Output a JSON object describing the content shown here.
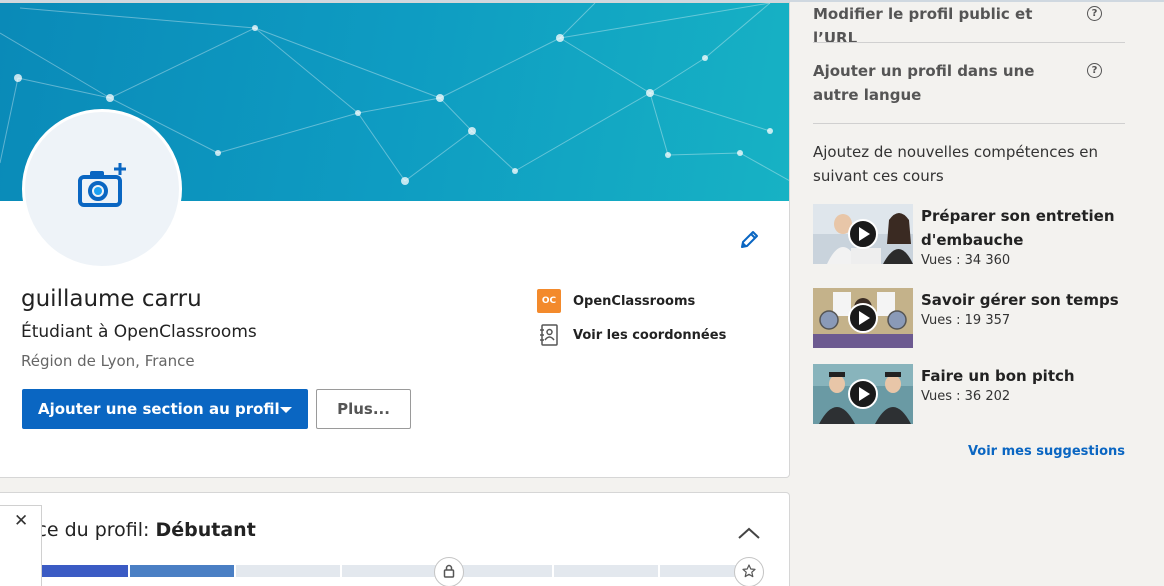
{
  "profile": {
    "name": "guillaume carru",
    "headline": "Étudiant à OpenClassrooms",
    "location": "Région de Lyon, France",
    "company_logo_text": "OC",
    "company": "OpenClassrooms",
    "contact_link": "Voir les coordonnées",
    "add_section_button": "Ajouter une section au profil",
    "more_button": "Plus..."
  },
  "strength": {
    "label": "rce du profil: ",
    "level": "Débutant",
    "progress_segments_filled": 2,
    "progress_segments_total": 7
  },
  "close_symbol": "✕",
  "rail": {
    "edit_public_profile": "Modifier le profil public et l’URL",
    "add_language_profile": "Ajouter un profil dans une autre langue",
    "help_symbol": "?",
    "courses_intro": "Ajoutez de nouvelles compétences en suivant ces cours",
    "courses": [
      {
        "title": "Préparer son entretien d'embauche",
        "views": "Vues : 34 360"
      },
      {
        "title": "Savoir gérer son temps",
        "views": "Vues : 19 357"
      },
      {
        "title": "Faire un bon pitch",
        "views": "Vues : 36 202"
      }
    ],
    "see_suggestions": "Voir mes suggestions"
  },
  "colors": {
    "primary": "#0a66c2",
    "banner_start": "#0a8ab8",
    "banner_end": "#17b2c4",
    "oc_orange": "#f38a2c",
    "progress_filled_a": "#3b5bc4",
    "progress_filled_b": "#4a7fc4",
    "progress_empty": "#e3e8ee"
  },
  "icons": {
    "avatar": "camera-add-icon",
    "edit": "pencil-icon",
    "contact": "address-book-icon",
    "collapse": "chevron-up-icon",
    "lock": "lock-icon",
    "star": "star-icon",
    "play": "play-icon"
  }
}
